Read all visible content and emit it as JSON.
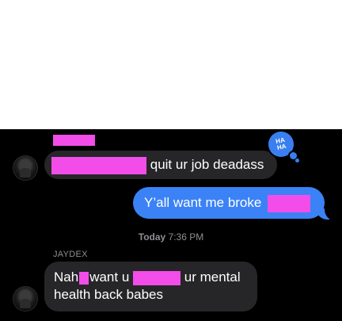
{
  "conversation": {
    "messages": [
      {
        "direction": "incoming",
        "text_after_redaction": "quit ur job deadass",
        "reaction": "HA\nHA"
      },
      {
        "direction": "outgoing",
        "text_before_redaction": "Y’all want me broke"
      },
      {
        "direction": "incoming",
        "sender": "JAYDEX",
        "segment_1": "Nah",
        "segment_2": "want u",
        "segment_3": "ur mental",
        "segment_4": "health back babes"
      }
    ],
    "timestamp": {
      "day": "Today",
      "time": "7:36 PM"
    }
  },
  "colors": {
    "background": "#000000",
    "incoming_bubble": "#262628",
    "outgoing_bubble": "#3b82f6",
    "redaction": "#f24de8",
    "tapback": "#3a7ff0",
    "meta_text": "#8e8e93"
  },
  "icons": {
    "avatar": "contact-avatar-icon",
    "reaction": "haha-tapback-icon"
  }
}
